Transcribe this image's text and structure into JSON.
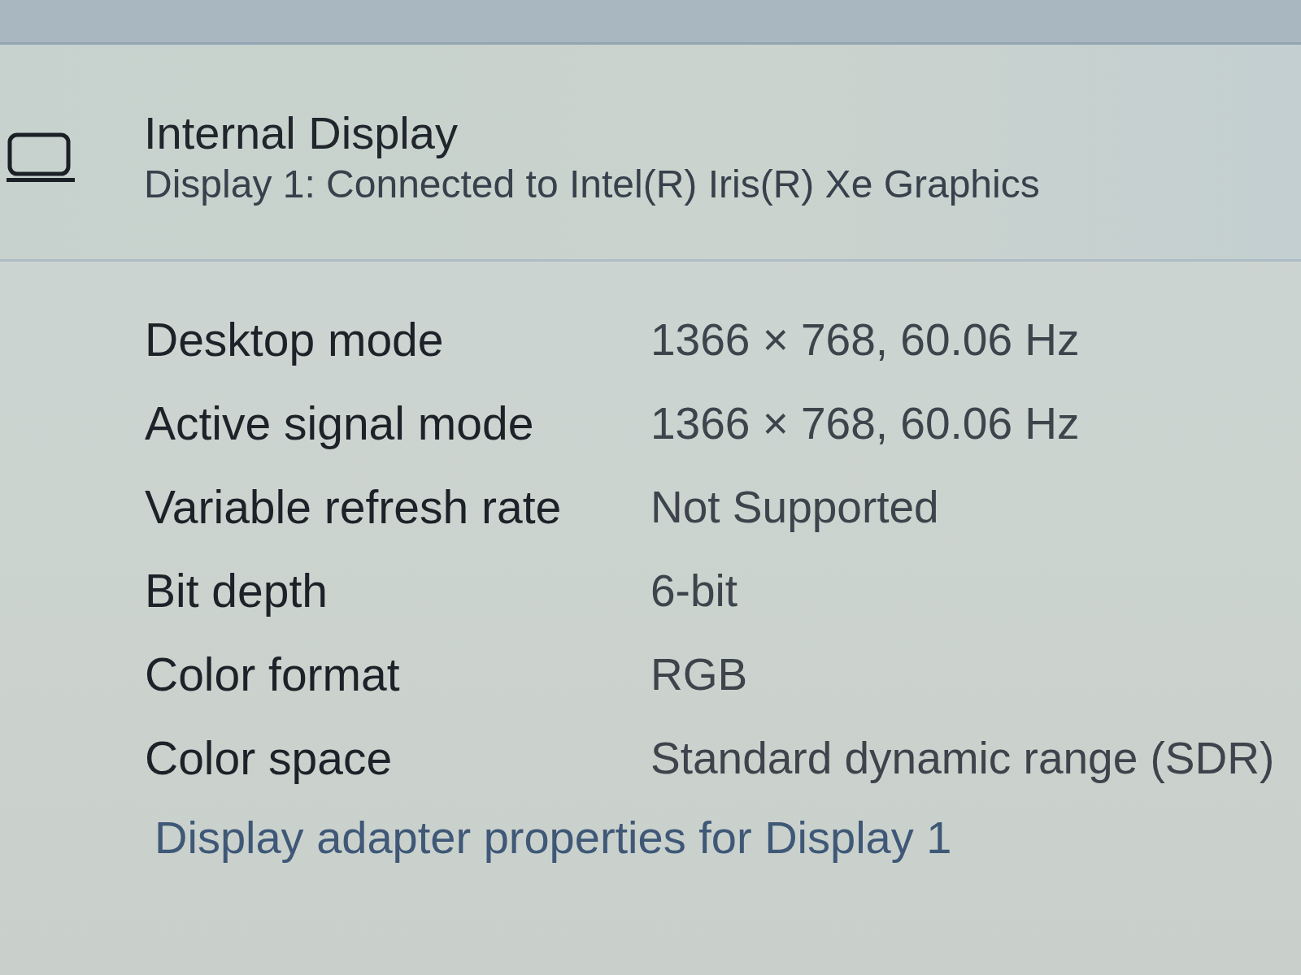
{
  "header": {
    "title": "Internal Display",
    "subtitle": "Display 1: Connected to Intel(R) Iris(R) Xe Graphics"
  },
  "properties": [
    {
      "label": "Desktop mode",
      "value": "1366 × 768, 60.06 Hz"
    },
    {
      "label": "Active signal mode",
      "value": "1366 × 768, 60.06 Hz"
    },
    {
      "label": "Variable refresh rate",
      "value": "Not Supported"
    },
    {
      "label": "Bit depth",
      "value": "6-bit"
    },
    {
      "label": "Color format",
      "value": "RGB"
    },
    {
      "label": "Color space",
      "value": "Standard dynamic range (SDR)"
    }
  ],
  "link": "Display adapter properties for Display 1"
}
